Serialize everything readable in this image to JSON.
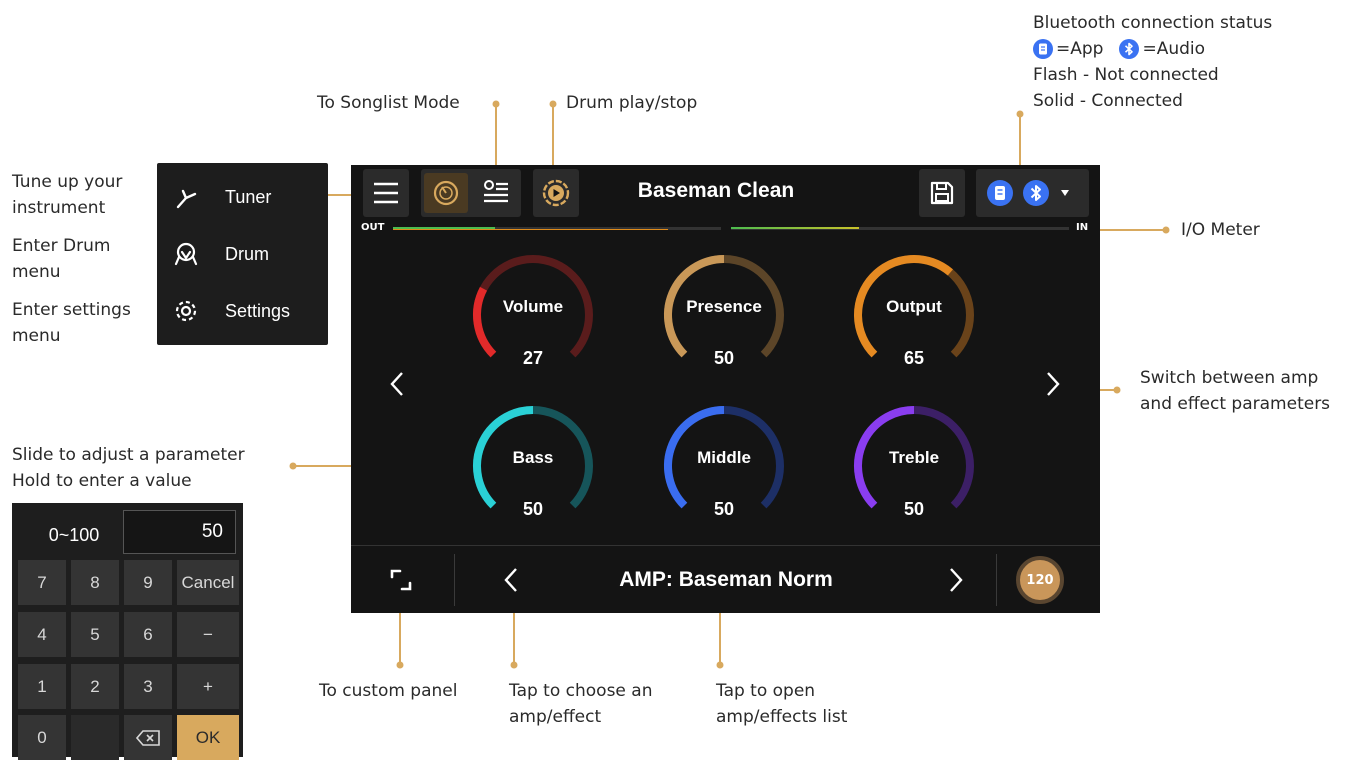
{
  "callouts": {
    "bluetooth": [
      "Bluetooth connection status",
      "=App",
      "=Audio",
      "Flash - Not connected",
      "Solid - Connected"
    ],
    "songlist": "To Songlist Mode",
    "drum_play": "Drum play/stop",
    "tuner": [
      "Tune up your",
      "instrument"
    ],
    "drum": [
      "Enter Drum",
      "menu"
    ],
    "settings": [
      "Enter settings",
      "menu"
    ],
    "io_meter": "I/O Meter",
    "switch": [
      "Switch between amp",
      "and effect parameters"
    ],
    "slide": [
      "Slide to adjust a parameter",
      "Hold to enter a value"
    ],
    "custom_panel": "To custom panel",
    "choose": [
      "Tap to choose an",
      "amp/effect"
    ],
    "open_list": [
      "Tap to open",
      "amp/effects list"
    ]
  },
  "screen": {
    "preset_name": "Baseman Clean",
    "meter_out_label": "OUT",
    "meter_in_label": "IN",
    "meter_out_level": 0.31,
    "meter_in_level": 0.38,
    "amp_name": "AMP: Baseman Norm",
    "tempo": "120",
    "knobs": [
      {
        "name": "Volume",
        "value": "27",
        "level": 0.27,
        "color": "#e22a2a",
        "track": "#5a1c1c"
      },
      {
        "name": "Presence",
        "value": "50",
        "level": 0.5,
        "color": "#c99858",
        "track": "#5c4528"
      },
      {
        "name": "Output",
        "value": "65",
        "level": 0.65,
        "color": "#e58a22",
        "track": "#6a431a"
      },
      {
        "name": "Bass",
        "value": "50",
        "level": 0.5,
        "color": "#2ad1d6",
        "track": "#16555a"
      },
      {
        "name": "Middle",
        "value": "50",
        "level": 0.5,
        "color": "#3a6df0",
        "track": "#1d2f66"
      },
      {
        "name": "Treble",
        "value": "50",
        "level": 0.5,
        "color": "#8a3df0",
        "track": "#3c1f66"
      }
    ]
  },
  "menu": {
    "items": [
      {
        "label": "Tuner",
        "icon": "tuning-fork-icon"
      },
      {
        "label": "Drum",
        "icon": "drum-icon"
      },
      {
        "label": "Settings",
        "icon": "gear-icon"
      }
    ]
  },
  "keypad": {
    "range": "0~100",
    "value": "50",
    "keys": [
      "7",
      "8",
      "9",
      "Cancel",
      "4",
      "5",
      "6",
      "−",
      "1",
      "2",
      "3",
      "+",
      "0",
      "",
      "⌫",
      "OK"
    ]
  },
  "colors": {
    "accent": "#d8a95e",
    "leader": "#d8a95e",
    "bluetooth": "#3a72f2"
  }
}
